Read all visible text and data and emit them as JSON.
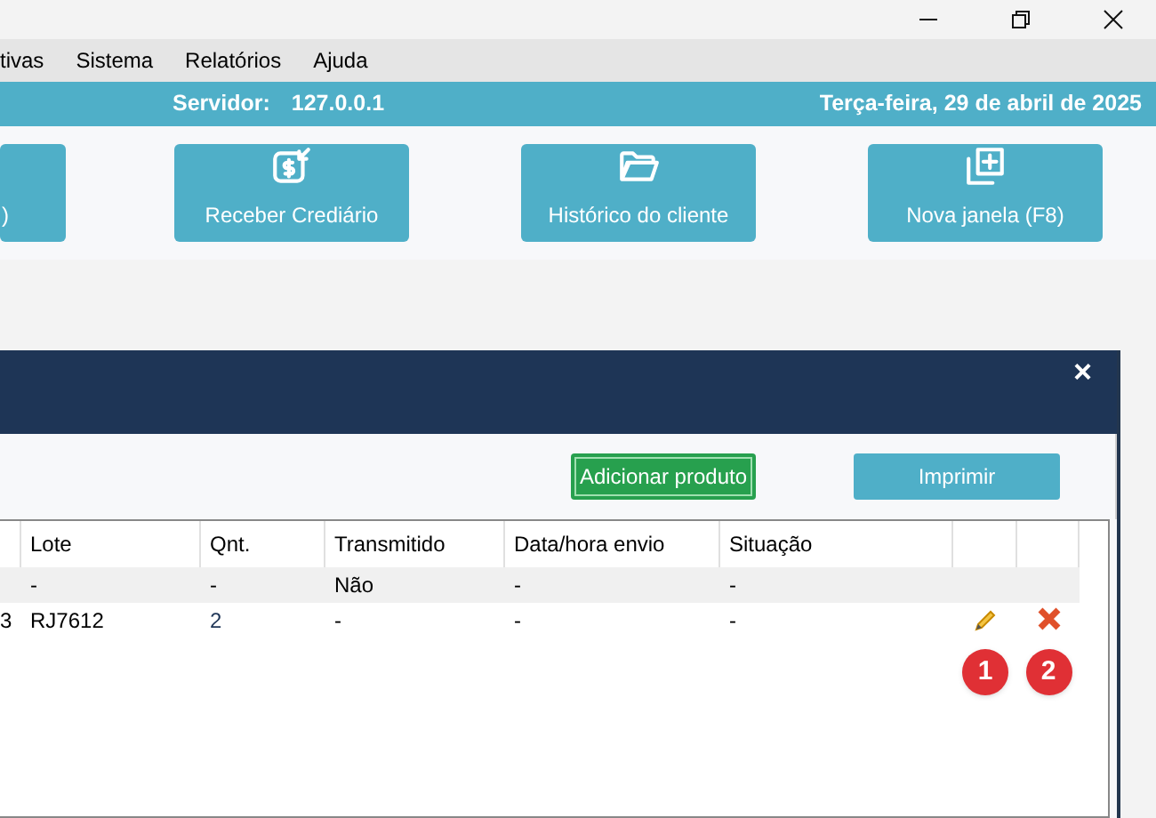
{
  "menu": [
    "tivas",
    "Sistema",
    "Relatórios",
    "Ajuda"
  ],
  "status_bar": {
    "server_label": "Servidor:",
    "server": "127.0.0.1",
    "date": "Terça-feira, 29 de abril de 2025"
  },
  "toolbar": [
    {
      "label": ")",
      "kind": "none"
    },
    {
      "label": "Receber Crediário",
      "kind": "credit"
    },
    {
      "label": "Histórico do cliente",
      "kind": "folder"
    },
    {
      "label": "Nova janela (F8)",
      "kind": "newwindow"
    }
  ],
  "dialog": {
    "close": "×",
    "buttons": [
      {
        "label": "Adicionar produto",
        "kind": "primary"
      },
      {
        "label": "Imprimir",
        "kind": "secondary"
      }
    ]
  },
  "table": {
    "columns": [
      "",
      "Lote",
      "Qnt.",
      "Transmitido",
      "Data/hora envio",
      "Situação",
      "",
      ""
    ],
    "rows": [
      {
        "cells": [
          "",
          "-",
          "-",
          "Não",
          "-",
          "-"
        ],
        "actions": false
      },
      {
        "cells": [
          "3",
          "RJ7612",
          "2",
          "-",
          "-",
          "-"
        ],
        "actions": true
      }
    ]
  },
  "badges": [
    "1",
    "2"
  ]
}
